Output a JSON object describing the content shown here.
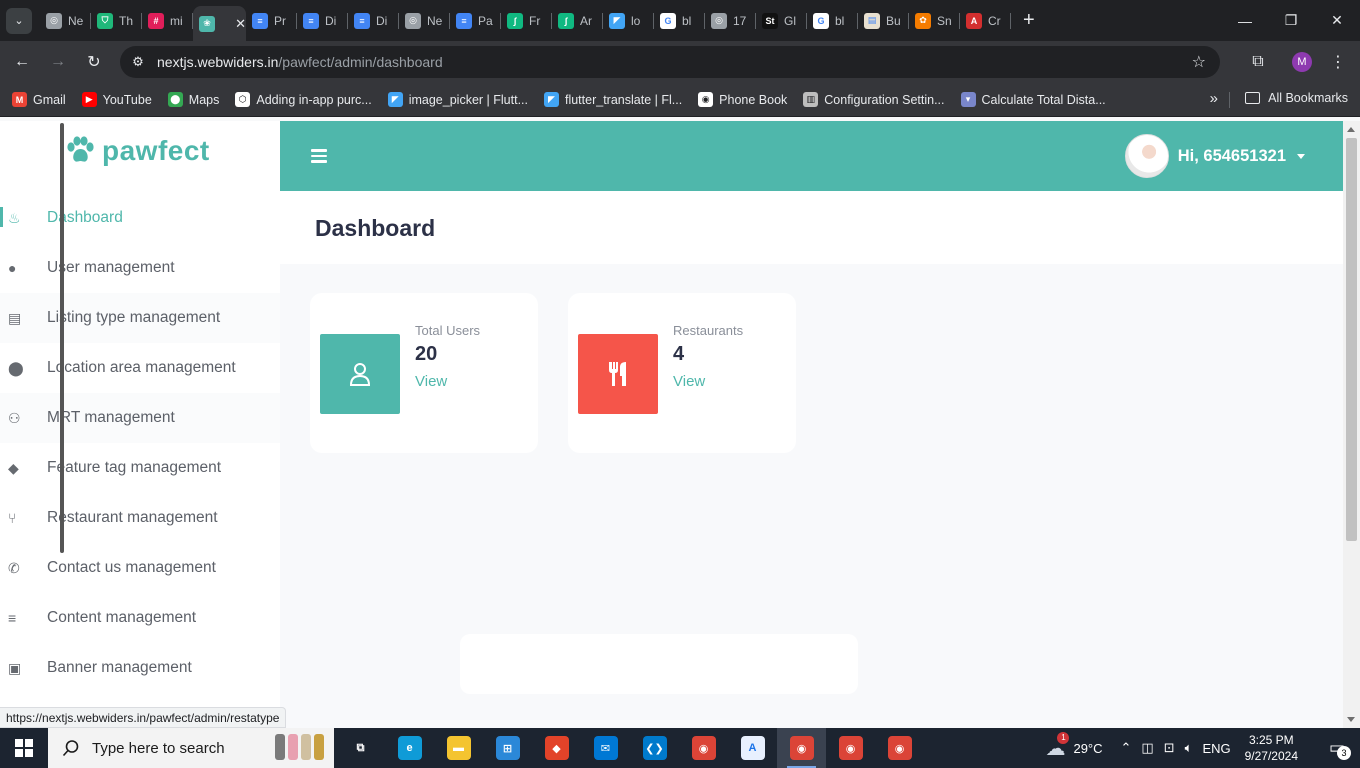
{
  "browser": {
    "tabs": [
      {
        "title": "Ne",
        "color": "#9aa0a6",
        "glyph": "◎"
      },
      {
        "title": "Th",
        "color": "#1fb87a",
        "glyph": "⛉"
      },
      {
        "title": "mi",
        "color": "#e01e5a",
        "glyph": "#"
      },
      {
        "title": "",
        "color": "#4fb7ab",
        "glyph": "❀",
        "active": true
      },
      {
        "title": "Pr",
        "color": "#4285f4",
        "glyph": "≡"
      },
      {
        "title": "Di",
        "color": "#4285f4",
        "glyph": "≡"
      },
      {
        "title": "Di",
        "color": "#4285f4",
        "glyph": "≡"
      },
      {
        "title": "Ne",
        "color": "#9aa0a6",
        "glyph": "◎"
      },
      {
        "title": "Pa",
        "color": "#4285f4",
        "glyph": "≡"
      },
      {
        "title": "Fr",
        "color": "#10b981",
        "glyph": "∫"
      },
      {
        "title": "Ar",
        "color": "#10b981",
        "glyph": "∫"
      },
      {
        "title": "lo",
        "color": "#42a5f5",
        "glyph": "◤"
      },
      {
        "title": "bl",
        "color": "#ffffff",
        "glyph": "G"
      },
      {
        "title": "17",
        "color": "#9aa0a6",
        "glyph": "◎"
      },
      {
        "title": "Gl",
        "color": "#111111",
        "glyph": "St"
      },
      {
        "title": "bl",
        "color": "#ffffff",
        "glyph": "G"
      },
      {
        "title": "Bu",
        "color": "#e8e0d0",
        "glyph": "▤"
      },
      {
        "title": "Sn",
        "color": "#f57c00",
        "glyph": "✿"
      },
      {
        "title": "Cr",
        "color": "#d32f2f",
        "glyph": "A"
      }
    ],
    "url_host": "nextjs.webwiders.in",
    "url_path": "/pawfect/admin/dashboard",
    "profile_initial": "M",
    "bookmarks": [
      {
        "label": "Gmail",
        "color": "#ea4335",
        "glyph": "M"
      },
      {
        "label": "YouTube",
        "color": "#ff0000",
        "glyph": "▶"
      },
      {
        "label": "Maps",
        "color": "#34a853",
        "glyph": "⬤"
      },
      {
        "label": "Adding in-app purc...",
        "color": "#ffffff",
        "glyph": "⬡"
      },
      {
        "label": "image_picker | Flutt...",
        "color": "#42a5f5",
        "glyph": "◤"
      },
      {
        "label": "flutter_translate | Fl...",
        "color": "#42a5f5",
        "glyph": "◤"
      },
      {
        "label": "Phone Book",
        "color": "#ffffff",
        "glyph": "◉"
      },
      {
        "label": "Configuration Settin...",
        "color": "#bdbdbd",
        "glyph": "▥"
      },
      {
        "label": "Calculate Total Dista...",
        "color": "#7986cb",
        "glyph": "▾"
      }
    ],
    "all_bookmarks": "All Bookmarks",
    "status_url": "https://nextjs.webwiders.in/pawfect/admin/restatype"
  },
  "app": {
    "brand": "pawfect",
    "accent": "#4fb7ab",
    "greeting": "Hi, 654651321",
    "page_title": "Dashboard",
    "menu": [
      {
        "label": "Dashboard",
        "icon": "fire-icon",
        "glyph": "♨",
        "active": true
      },
      {
        "label": "User management",
        "icon": "user-icon",
        "glyph": "●"
      },
      {
        "label": "Listing type management",
        "icon": "clipboard-icon",
        "glyph": "▤"
      },
      {
        "label": "Location area management",
        "icon": "map-pin-icon",
        "glyph": "⬤"
      },
      {
        "label": "MRT management",
        "icon": "people-icon",
        "glyph": "⚇"
      },
      {
        "label": "Feature tag management",
        "icon": "tags-icon",
        "glyph": "◆"
      },
      {
        "label": "Restaurant management",
        "icon": "utensils-icon",
        "glyph": "⑂"
      },
      {
        "label": "Contact us management",
        "icon": "phone-icon",
        "glyph": "✆"
      },
      {
        "label": "Content management",
        "icon": "list-icon",
        "glyph": "≡"
      },
      {
        "label": "Banner management",
        "icon": "images-icon",
        "glyph": "▣"
      }
    ],
    "cards": [
      {
        "label": "Total Users",
        "value": "20",
        "link": "View",
        "color": "#4fb7ab",
        "icon": "user-icon"
      },
      {
        "label": "Restaurants",
        "value": "4",
        "link": "View",
        "color": "#f5554a",
        "icon": "utensils-icon"
      }
    ]
  },
  "taskbar": {
    "search_placeholder": "Type here to search",
    "weather": "29°C",
    "weather_badge": "1",
    "language": "ENG",
    "time": "3:25 PM",
    "date": "9/27/2024",
    "notification_count": "3",
    "apps": [
      {
        "name": "task-view",
        "color": "#1c2430",
        "glyph": "⧉"
      },
      {
        "name": "edge",
        "color": "#0f9bd7",
        "glyph": "e"
      },
      {
        "name": "file-explorer",
        "color": "#f4c430",
        "glyph": "▬"
      },
      {
        "name": "store",
        "color": "#2b88d8",
        "glyph": "⊞"
      },
      {
        "name": "git-app",
        "color": "#e24329",
        "glyph": "◆"
      },
      {
        "name": "mail",
        "color": "#0078d4",
        "glyph": "✉"
      },
      {
        "name": "vscode",
        "color": "#007acc",
        "glyph": "❮❯"
      },
      {
        "name": "chrome",
        "color": "#db4437",
        "glyph": "◉"
      },
      {
        "name": "android-studio",
        "color": "#e8f0fe",
        "glyph": "A"
      },
      {
        "name": "chrome-profile-m",
        "color": "#db4437",
        "glyph": "◉",
        "active": true
      },
      {
        "name": "chrome-2",
        "color": "#db4437",
        "glyph": "◉"
      },
      {
        "name": "chrome-profile-p",
        "color": "#db4437",
        "glyph": "◉"
      }
    ]
  }
}
